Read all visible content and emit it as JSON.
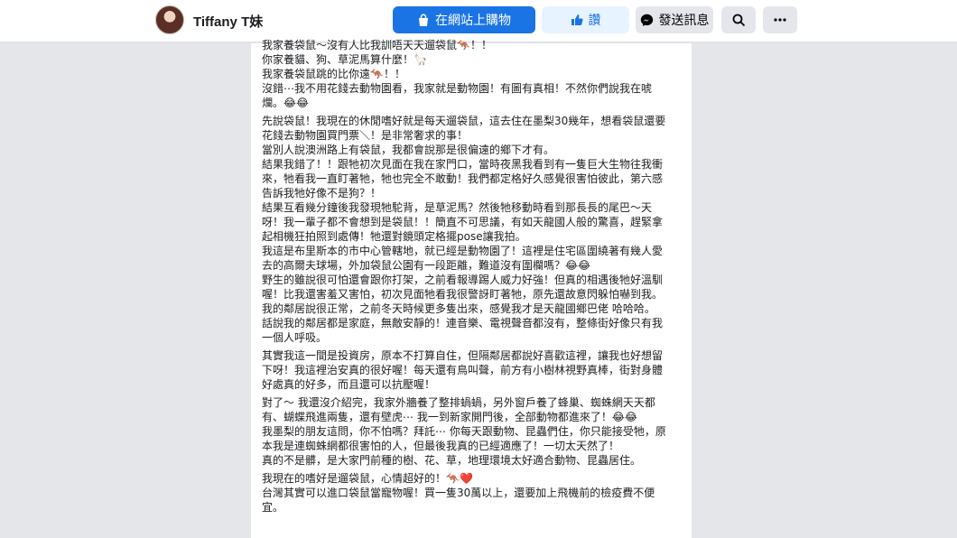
{
  "header": {
    "profile_name": "Tiffany T妹",
    "shop_label": "在網站上購物",
    "like_label": "讚",
    "message_label": "發送訊息",
    "icons": [
      "shopping-bag-icon",
      "thumbs-up-icon",
      "messenger-icon",
      "search-icon",
      "more-icon"
    ]
  },
  "colors": {
    "primary": "#1b74e4",
    "like_bg": "#e7f3ff",
    "button_bg": "#e4e6eb",
    "page_bg": "#e4e6ea"
  },
  "post": {
    "paragraphs": [
      [
        "我家養袋鼠～沒有人比我訓唔天天遛袋鼠🦘！！",
        "你家養貓、狗、草泥馬算什麼！🦙",
        "我家養袋鼠跳的比你遠🦘！！",
        "沒錯⋯我不用花錢去動物園看，我家就是動物園！有圖有真相！不然你們說我在唬",
        "爛。😂😂"
      ],
      [
        "先說袋鼠！我現在的休閒嗜好就是每天遛袋鼠，這去住在墨梨30幾年，想看袋鼠還要",
        "花錢去動物園買門票＼！是非常奢求的事！",
        "當別人說澳洲路上有袋鼠，我都會說那是很偏遠的鄉下才有。",
        "結果我錯了！！跟牠初次見面在我在家門口，當時夜黑我看到有一隻巨大生物往我衝",
        "來，牠看我一直盯著牠，牠也完全不敢動！我們都定格好久感覺很害怕彼此，第六感",
        "告訴我牠好像不是狗？！",
        "結果互看幾分鐘後我發現牠駝背，是草泥馬？然後牠移動時看到那長長的尾巴～天",
        "呀！我一輩子都不會想到是袋鼠！！簡直不可思議，有如天龍國人般的驚喜，趕緊拿",
        "起相機狂拍照到處傳！牠還對鏡頭定格擺pose讓我拍。",
        "我這是布里斯本的市中心管轄地，就已經是動物園了！這裡是住宅區圍繞著有幾人愛",
        "去的高爾夫球場，外加袋鼠公園有一段距離，難道沒有圍欄嗎？😂😂",
        "野生的雖說很可怕還會跟你打架，之前看報導踢人威力好強！但真的相遇後牠好溫馴",
        "喔！比我還害羞又害怕，初次見面牠看我很警訝盯著牠，原先還故意閃躲怕嚇到我。",
        "我的鄰居說很正常，之前冬天時候更多隻出來，感覺我才是天龍國鄉巴佬 哈哈哈。",
        "話說我的鄰居都是家庭，無敵安靜的！連音樂、電視聲音都沒有，整條街好像只有我",
        "一個人呼吸。"
      ],
      [
        "其實我這一間是投資房，原本不打算自住，但隔鄰居都說好喜歡這裡，讓我也好想留",
        "下呀！我這裡治安真的很好喔！每天還有鳥叫聲，前方有小樹林視野真棒，街對身體",
        "好處真的好多，而且還可以抗壓喔！"
      ],
      [
        "對了～ 我還沒介紹完，我家外牆養了整排蝸蝸，另外窗戶養了蜂巢、蜘蛛網天天都",
        "有、蝴蝶飛進兩隻，還有壁虎⋯ 我一到新家開門後，全部動物都進來了！😂😂",
        "我墨梨的朋友這問，你不怕嗎？拜託⋯ 你每天跟動物、昆蟲們住，你只能接受牠，原",
        "本我是連蜘蛛網都很害怕的人，但最後我真的已經適應了！一切太天然了！",
        "真的不是髒，是大家門前種的樹、花、草，地理環境太好適合動物、昆蟲居住。"
      ],
      [
        "我現在的嗜好是遛袋鼠，心情超好的！🦘❤️",
        "台灣其實可以進口袋鼠當寵物喔！買一隻30萬以上，還要加上飛機前的檢疫費不便",
        "宜。"
      ]
    ]
  }
}
